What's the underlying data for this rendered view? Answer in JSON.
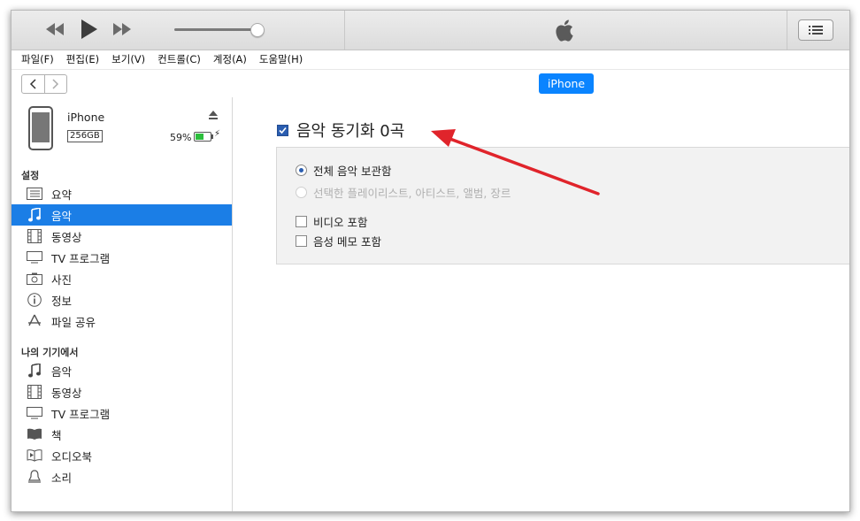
{
  "toolbar": {
    "prev_icon": "rewind-icon",
    "play_icon": "play-icon",
    "next_icon": "fast-forward-icon",
    "volume_level": 0.85,
    "logo_icon": "apple-logo-icon",
    "list_icon": "list-view-icon"
  },
  "menubar": {
    "items": [
      "파일(F)",
      "편집(E)",
      "보기(V)",
      "컨트롤(C)",
      "계정(A)",
      "도움말(H)"
    ]
  },
  "nav": {
    "device_button": "iPhone"
  },
  "device": {
    "name": "iPhone",
    "capacity": "256GB",
    "battery": "59%",
    "battery_level": 0.59
  },
  "sidebar": {
    "settings_header": "설정",
    "settings_items": [
      {
        "label": "요약",
        "icon": "summary-icon"
      },
      {
        "label": "음악",
        "icon": "music-note-icon"
      },
      {
        "label": "동영상",
        "icon": "film-icon"
      },
      {
        "label": "TV 프로그램",
        "icon": "tv-icon"
      },
      {
        "label": "사진",
        "icon": "camera-icon"
      },
      {
        "label": "정보",
        "icon": "info-icon"
      },
      {
        "label": "파일 공유",
        "icon": "app-store-icon"
      }
    ],
    "device_header": "나의 기기에서",
    "device_items": [
      {
        "label": "음악",
        "icon": "music-note-icon"
      },
      {
        "label": "동영상",
        "icon": "film-icon"
      },
      {
        "label": "TV 프로그램",
        "icon": "tv-icon"
      },
      {
        "label": "책",
        "icon": "book-icon"
      },
      {
        "label": "오디오북",
        "icon": "audiobook-icon"
      },
      {
        "label": "소리",
        "icon": "bell-icon"
      }
    ],
    "active": "음악"
  },
  "main": {
    "sync_label": "음악 동기화 0곡",
    "sync_checked": true,
    "options": {
      "entire_library": "전체 음악 보관함",
      "selected": "선택한 플레이리스트, 아티스트, 앨범, 장르",
      "include_videos": "비디오 포함",
      "include_voice_memos": "음성 메모 포함"
    }
  },
  "colors": {
    "accent": "#1b7ee6",
    "pill": "#0a84ff",
    "annotation_arrow": "#e0242b"
  }
}
